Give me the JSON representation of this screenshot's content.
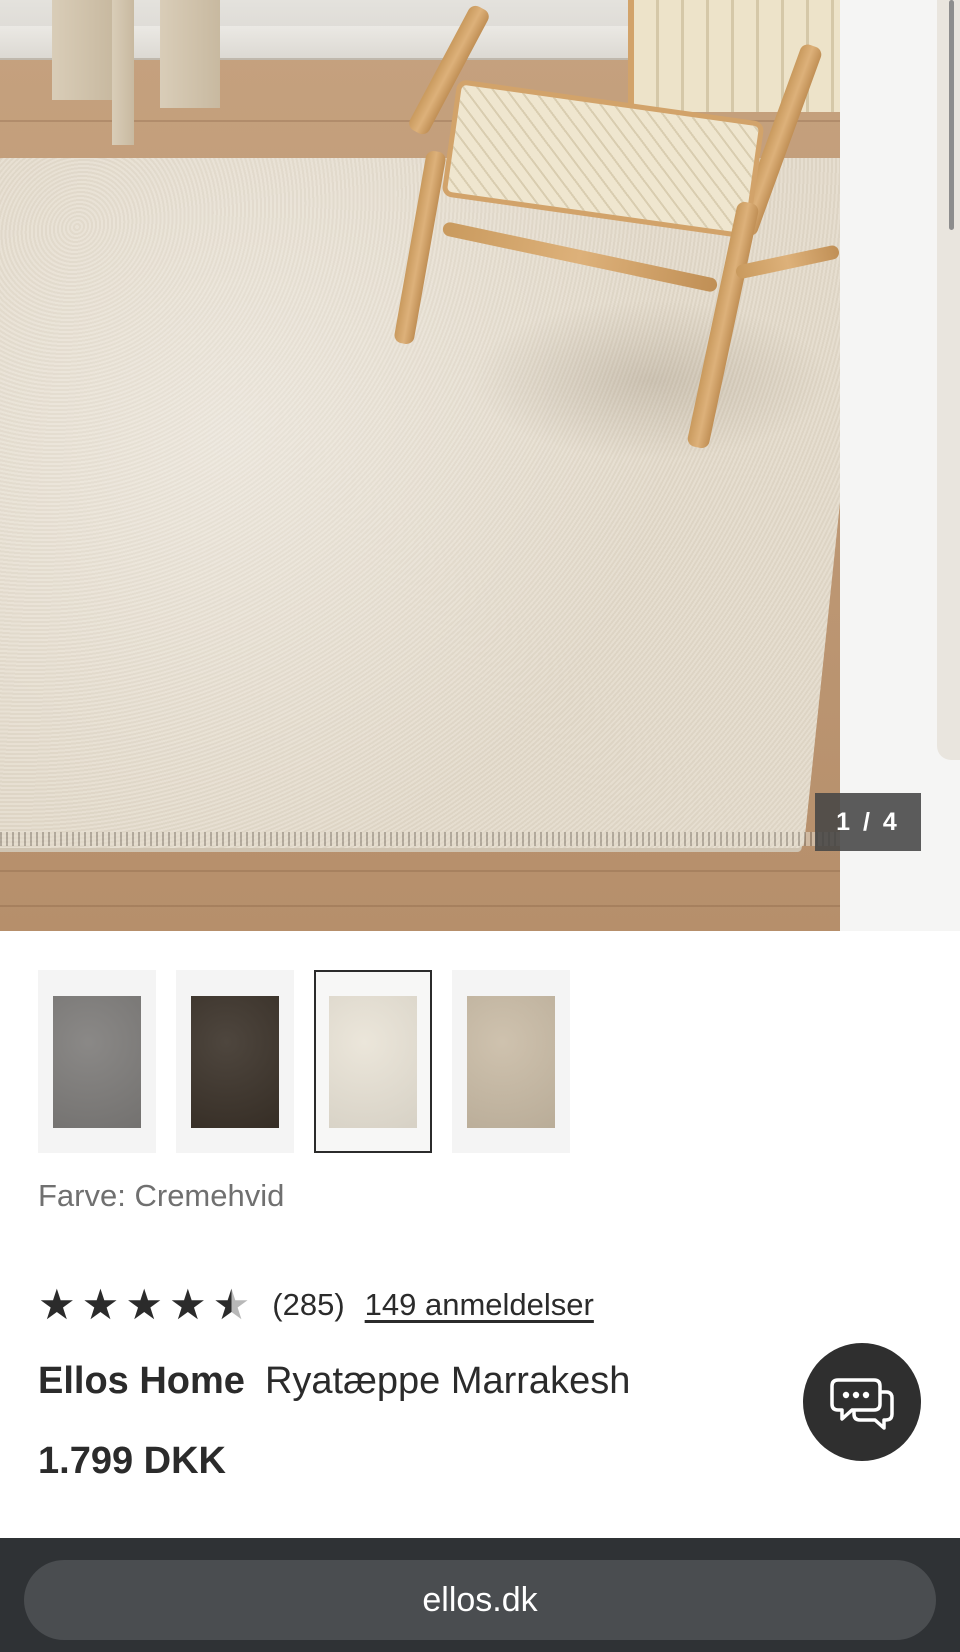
{
  "gallery": {
    "counter": "1 / 4",
    "current_index": 1,
    "total": 4
  },
  "thumbnails": [
    {
      "name": "grey",
      "color": "#7d7b79",
      "selected": false
    },
    {
      "name": "dark-brown",
      "color": "#3a3128",
      "selected": false
    },
    {
      "name": "cream",
      "color": "#e9e3d6",
      "selected": true
    },
    {
      "name": "beige",
      "color": "#c9bba5",
      "selected": false
    }
  ],
  "color_selection": {
    "label": "Farve:",
    "value": "Cremehvid"
  },
  "rating": {
    "score": 4.5,
    "max": 5,
    "count": "(285)",
    "reviews_link": "149 anmeldelser"
  },
  "product": {
    "brand": "Ellos Home",
    "name": "Ryatæppe Marrakesh",
    "price": "1.799 DKK"
  },
  "chat": {
    "icon": "chat-bubbles-icon"
  },
  "browser": {
    "url": "ellos.dk"
  },
  "colors": {
    "text": "#2b2b2b",
    "muted": "#707070",
    "chat_bg": "#2f2f2f",
    "browser_bg": "#2f3235",
    "url_pill": "#4a4d50"
  }
}
